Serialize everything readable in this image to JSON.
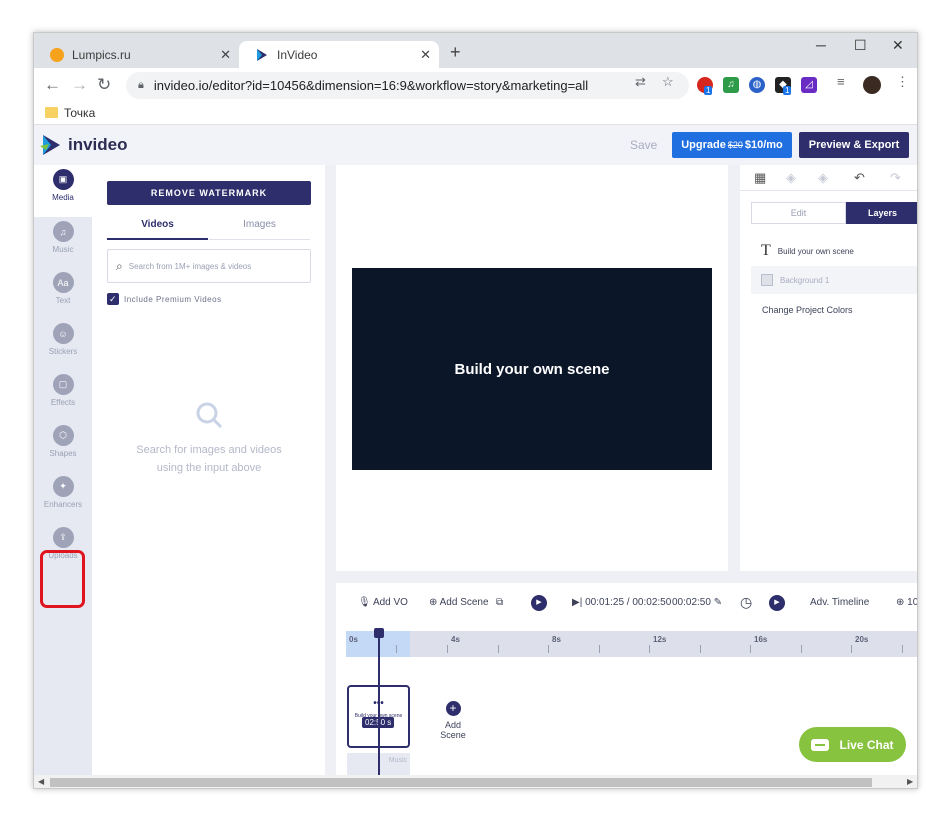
{
  "browser": {
    "tabs": [
      {
        "title": "Lumpics.ru",
        "active": false
      },
      {
        "title": "InVideo",
        "active": true
      }
    ],
    "url": "invideo.io/editor?id=10456&dimension=16:9&workflow=story&marketing=all",
    "bookmarks": [
      {
        "label": "Точка"
      }
    ],
    "extension_badges": [
      "1",
      "1"
    ]
  },
  "header": {
    "logo": "invideo",
    "save_label": "Save",
    "upgrade": {
      "prefix": "Upgrade",
      "old_price": "$20",
      "price": "$10/mo"
    },
    "preview_label": "Preview & Export"
  },
  "sidebar": {
    "items": [
      {
        "label": "Media",
        "icon": "image-icon",
        "active": true
      },
      {
        "label": "Music",
        "icon": "music-note-icon",
        "active": false
      },
      {
        "label": "Text",
        "icon": "text-icon",
        "glyph": "Aa",
        "active": false
      },
      {
        "label": "Stickers",
        "icon": "sticker-icon",
        "active": false
      },
      {
        "label": "Effects",
        "icon": "effects-icon",
        "active": false
      },
      {
        "label": "Shapes",
        "icon": "shapes-icon",
        "active": false
      },
      {
        "label": "Enhancers",
        "icon": "magic-wand-icon",
        "active": false
      },
      {
        "label": "Uploads",
        "icon": "upload-icon",
        "active": false
      }
    ]
  },
  "media_panel": {
    "remove_watermark_label": "REMOVE WATERMARK",
    "tabs": [
      {
        "label": "Videos",
        "active": true
      },
      {
        "label": "Images",
        "active": false
      }
    ],
    "search_placeholder": "Search from 1M+ images & videos",
    "include_premium_label": "Include Premium Videos",
    "include_premium_checked": true,
    "empty_line1": "Search for images and videos",
    "empty_line2": "using the input above"
  },
  "canvas": {
    "scene_text": "Build your own scene",
    "scene_bg": "#0b1629"
  },
  "layers_panel": {
    "tab_edit": "Edit",
    "tab_layers": "Layers",
    "layers": [
      {
        "label": "Build your own scene",
        "type": "text"
      },
      {
        "label": "Background 1",
        "type": "background"
      }
    ],
    "change_colors_label": "Change Project Colors"
  },
  "timeline": {
    "add_vo": "Add VO",
    "add_scene": "Add Scene",
    "current_time": "00:01:25",
    "total_time": "00:02:50",
    "scene_duration": "00:02:50",
    "adv_timeline": "Adv. Timeline",
    "zoom_label": "10",
    "ruler_labels": [
      "0s",
      "4s",
      "8s",
      "12s",
      "16s",
      "20s"
    ],
    "clip": {
      "title": "Build your own scene",
      "duration": "02:50 s"
    },
    "music_label": "Music",
    "add_scene_card": "Add Scene"
  },
  "live_chat_label": "Live Chat",
  "colors": {
    "brand_dark": "#2d2e6b",
    "upgrade_blue": "#1f6fe0",
    "live_chat_green": "#87c33f",
    "highlight_red": "#e0141e"
  }
}
